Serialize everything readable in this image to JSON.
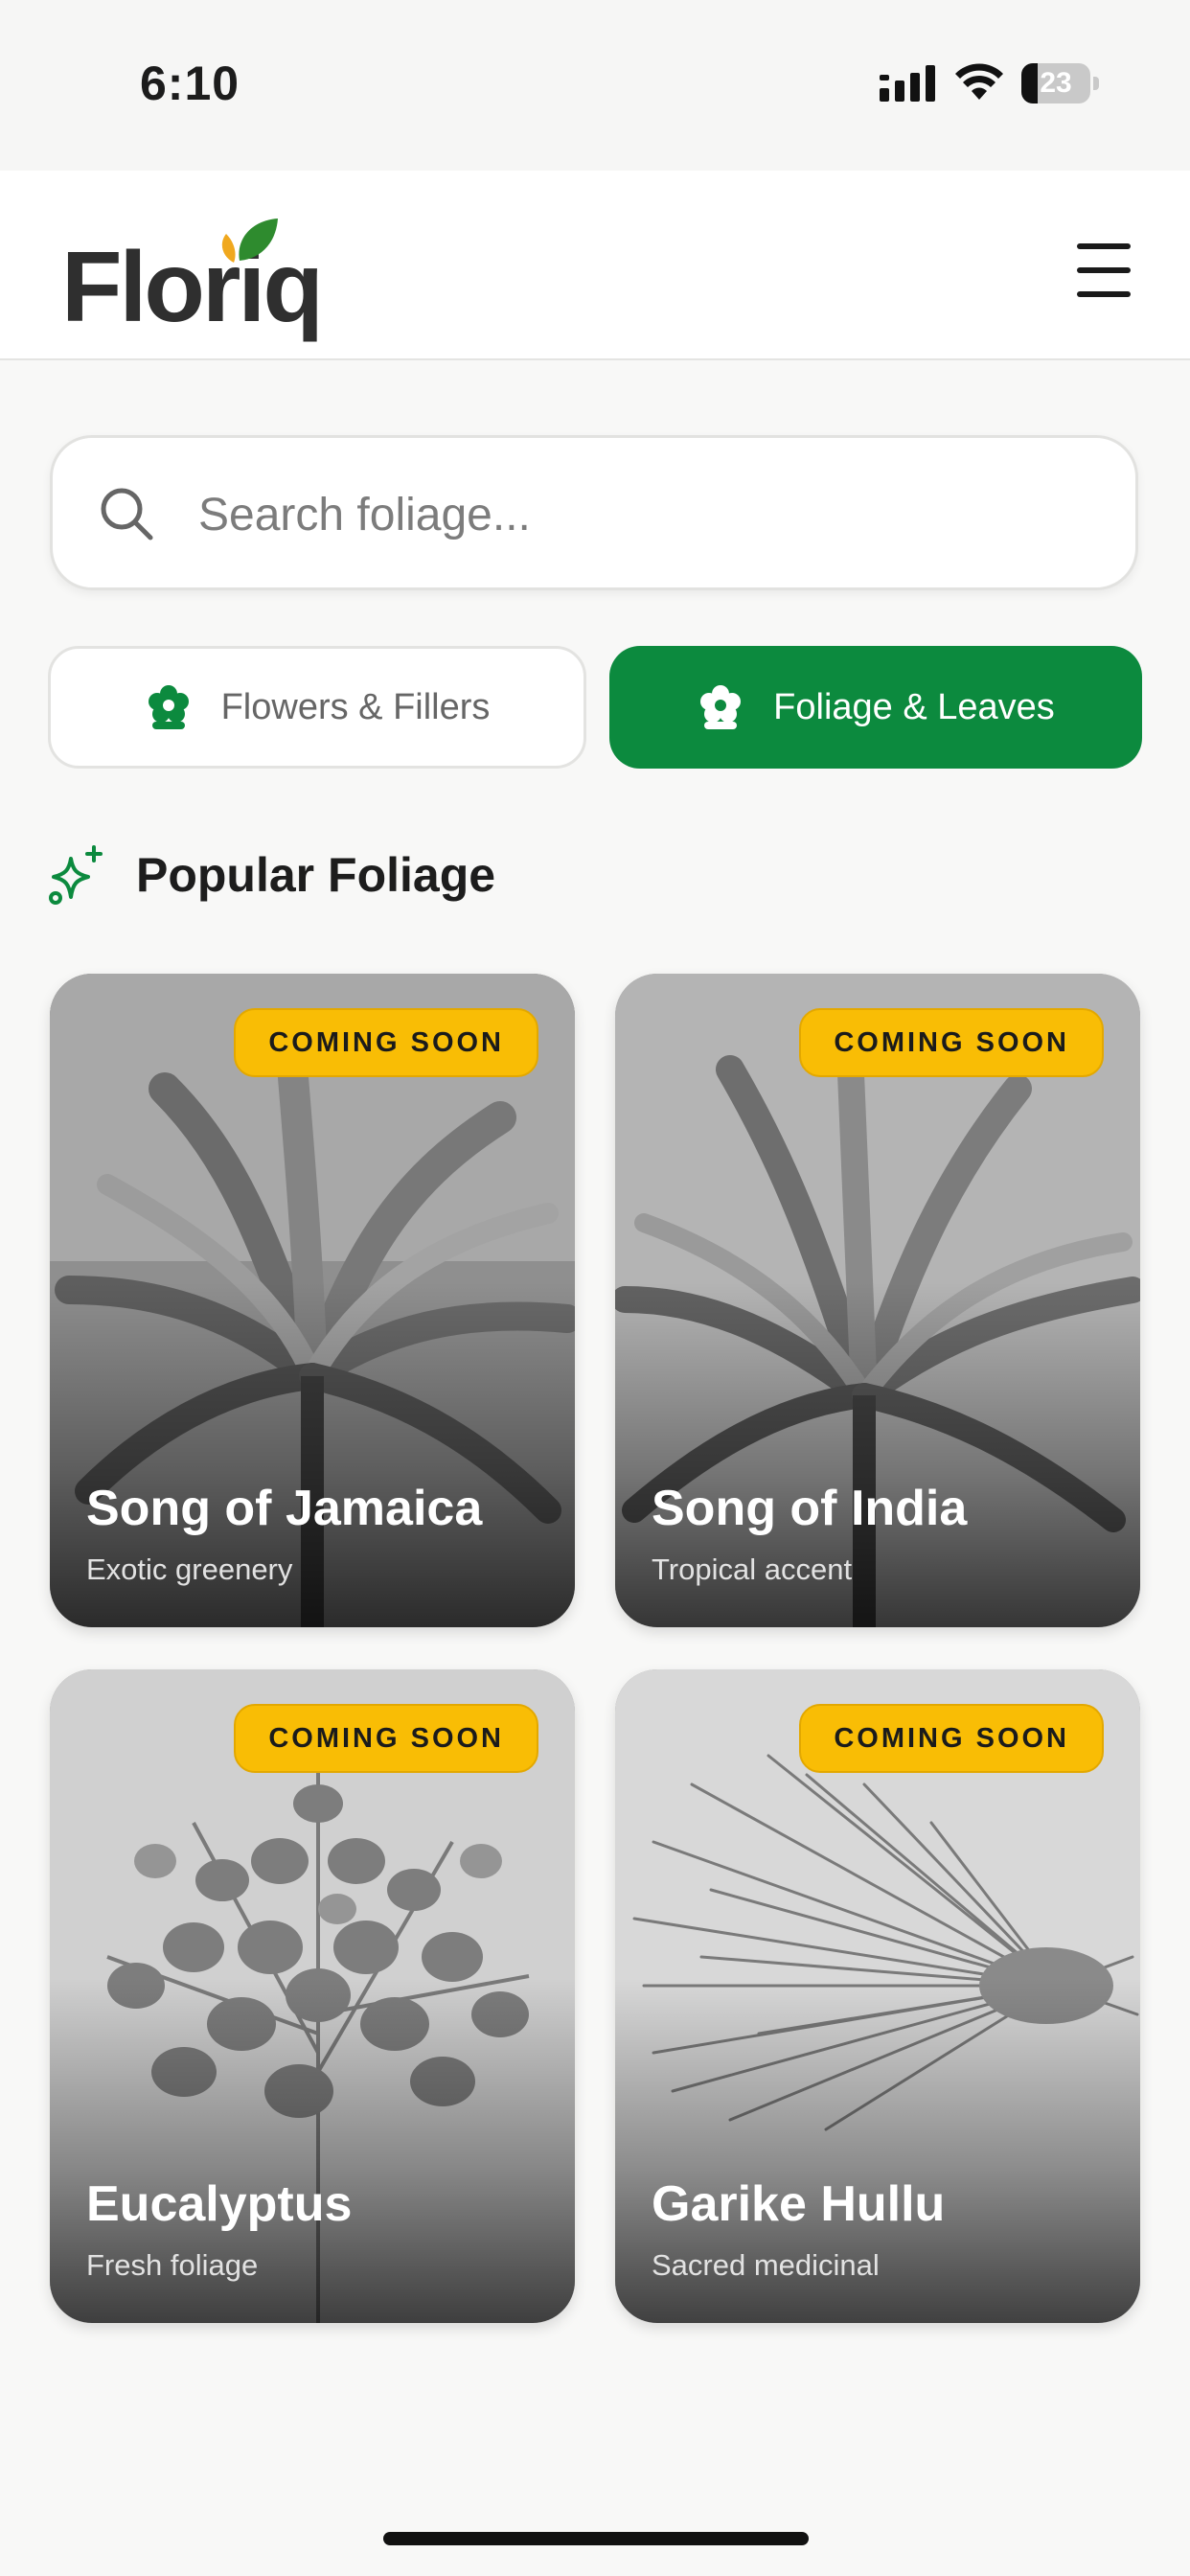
{
  "status_bar": {
    "time": "6:10",
    "battery": "23",
    "battery_level": 0.23
  },
  "header": {
    "logo_text": "Floriq"
  },
  "search": {
    "placeholder": "Search foliage..."
  },
  "tabs": [
    {
      "label": "Flowers & Fillers",
      "active": false
    },
    {
      "label": "Foliage & Leaves",
      "active": true
    }
  ],
  "section": {
    "title": "Popular Foliage"
  },
  "cards": [
    {
      "title": "Song of Jamaica",
      "subtitle": "Exotic greenery",
      "badge": "COMING SOON"
    },
    {
      "title": "Song of India",
      "subtitle": "Tropical accent",
      "badge": "COMING SOON"
    },
    {
      "title": "Eucalyptus",
      "subtitle": "Fresh foliage",
      "badge": "COMING SOON"
    },
    {
      "title": "Garike Hullu",
      "subtitle": "Sacred medicinal",
      "badge": "COMING SOON"
    }
  ],
  "colors": {
    "brand_green": "#0c8a3e",
    "badge_yellow": "#f9bd05",
    "logo_leaf_green": "#2e8b2e",
    "logo_leaf_orange": "#f0a81e"
  },
  "icons": {
    "search": "search-icon",
    "menu": "hamburger-menu-icon",
    "tab": "flower-icon",
    "section": "sparkle-icon"
  }
}
